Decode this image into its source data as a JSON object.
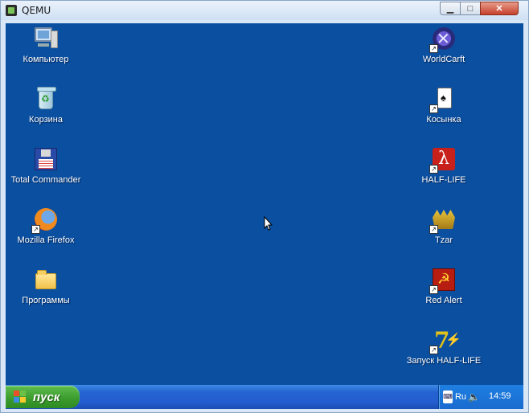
{
  "window": {
    "title": "QEMU"
  },
  "desktop": {
    "left_icons": [
      {
        "label": "Компьютер"
      },
      {
        "label": "Корзина"
      },
      {
        "label": "Total Commander"
      },
      {
        "label": "Mozilla Firefox"
      },
      {
        "label": "Программы"
      }
    ],
    "right_icons": [
      {
        "label": "WorldCarft"
      },
      {
        "label": "Косынка"
      },
      {
        "label": "HALF-LIFE"
      },
      {
        "label": "Tzar"
      },
      {
        "label": "Red Alert"
      },
      {
        "label": "Запуск HALF-LIFE"
      }
    ]
  },
  "taskbar": {
    "start_label": "пуск",
    "tray": {
      "language": "Ru",
      "clock": "14:59"
    }
  }
}
